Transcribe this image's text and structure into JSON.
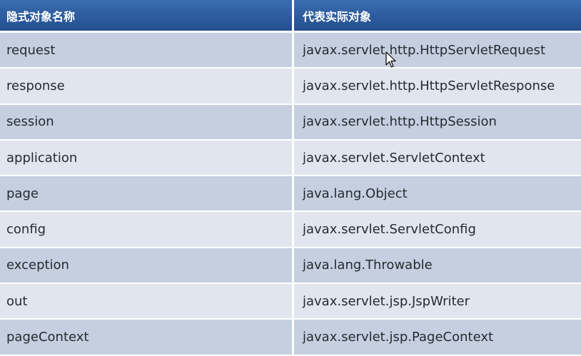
{
  "header": {
    "col1": "隐式对象名称",
    "col2": "代表实际对象"
  },
  "rows": [
    {
      "name": "request",
      "type": "javax.servlet.http.HttpServletRequest"
    },
    {
      "name": "response",
      "type": "javax.servlet.http.HttpServletResponse"
    },
    {
      "name": "session",
      "type": "javax.servlet.http.HttpSession"
    },
    {
      "name": "application",
      "type": "javax.servlet.ServletContext"
    },
    {
      "name": "page",
      "type": "java.lang.Object"
    },
    {
      "name": "config",
      "type": "javax.servlet.ServletConfig"
    },
    {
      "name": "exception",
      "type": "java.lang.Throwable"
    },
    {
      "name": "out",
      "type": "javax.servlet.jsp.JspWriter"
    },
    {
      "name": "pageContext",
      "type": "javax.servlet.jsp.PageContext"
    }
  ],
  "colors": {
    "header": "#2c5a9c",
    "row_odd": "#c5cfdf",
    "row_even": "#e1e6ee"
  },
  "icons": {
    "cursor": "mouse-pointer-icon"
  }
}
